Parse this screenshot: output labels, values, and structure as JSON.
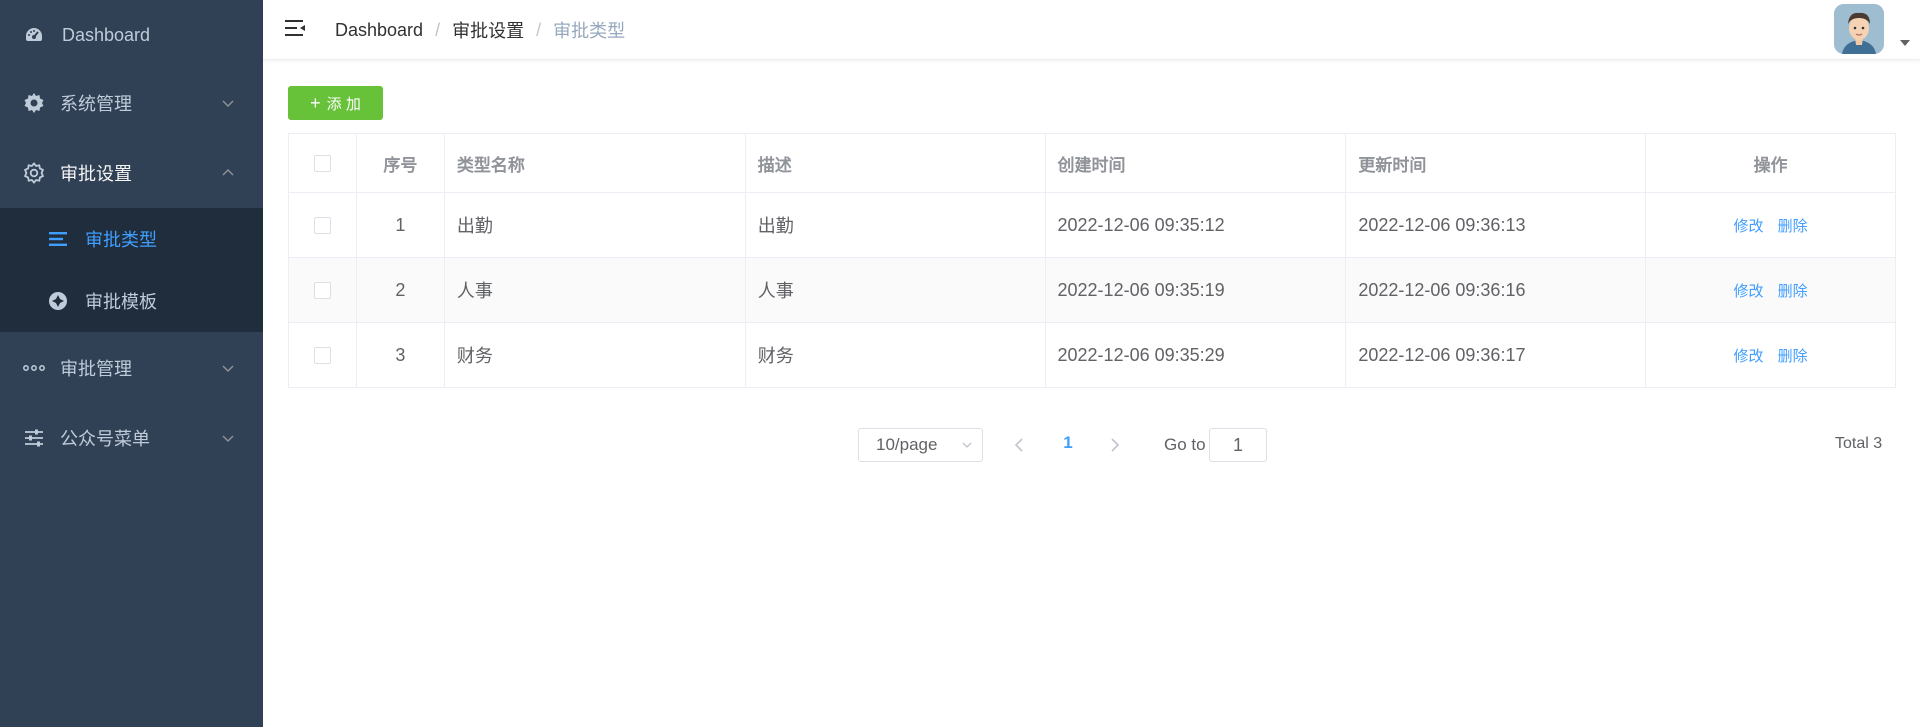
{
  "sidebar": {
    "items": [
      {
        "label": "Dashboard",
        "icon": "dashboard-icon"
      },
      {
        "label": "系统管理",
        "icon": "gear-icon"
      },
      {
        "label": "审批设置",
        "icon": "setting-icon"
      },
      {
        "label": "审批管理",
        "icon": "more-icon"
      },
      {
        "label": "公众号菜单",
        "icon": "sliders-icon"
      }
    ],
    "submenu": [
      {
        "label": "审批类型",
        "icon": "list-icon"
      },
      {
        "label": "审批模板",
        "icon": "aperture-icon"
      }
    ]
  },
  "header": {
    "breadcrumb": [
      "Dashboard",
      "审批设置",
      "审批类型"
    ],
    "separator": "/"
  },
  "toolbar": {
    "add_label": "添 加",
    "add_icon": "+"
  },
  "table": {
    "columns": [
      "序号",
      "类型名称",
      "描述",
      "创建时间",
      "更新时间",
      "操作"
    ],
    "rows": [
      {
        "idx": "1",
        "name": "出勤",
        "desc": "出勤",
        "created": "2022-12-06 09:35:12",
        "updated": "2022-12-06 09:36:13"
      },
      {
        "idx": "2",
        "name": "人事",
        "desc": "人事",
        "created": "2022-12-06 09:35:19",
        "updated": "2022-12-06 09:36:16"
      },
      {
        "idx": "3",
        "name": "财务",
        "desc": "财务",
        "created": "2022-12-06 09:35:29",
        "updated": "2022-12-06 09:36:17"
      }
    ],
    "edit_label": "修改",
    "delete_label": "删除"
  },
  "pagination": {
    "page_size": "10/page",
    "current_page": "1",
    "goto_label": "Go to",
    "goto_value": "1",
    "total": "Total 3"
  },
  "colors": {
    "sidebar_bg": "#304156",
    "submenu_bg": "#1f2d3d",
    "accent": "#409eff",
    "add_button": "#67c23a"
  }
}
